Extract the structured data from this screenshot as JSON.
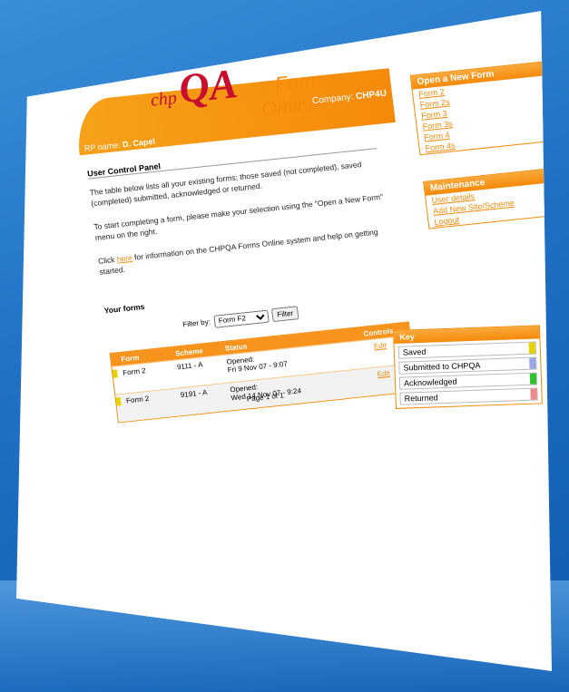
{
  "header": {
    "logo_chp": "chp",
    "logo_qa": "QA",
    "tagline": ":: Forms Online",
    "company_label": "Company:",
    "company_value": "CHP4U",
    "user_label": "RP name:",
    "user_value": "D. Capel"
  },
  "panel": {
    "title": "User Control Panel",
    "para1": "The table below lists all your existing forms; those saved (not completed), saved (completed) submitted, acknowledged or returned.",
    "para2": "To start completing a form, please make your selection using the \"Open a New Form\" menu on the right.",
    "para3_pre": "Click",
    "para3_link": "here",
    "para3_post": "for information on the CHPQA Forms Online system and help on getting started."
  },
  "your_forms": {
    "title": "Your forms",
    "filter_label": "Filter by:",
    "filter_value": "Form F2",
    "filter_button": "Filter",
    "columns": [
      "Form",
      "Scheme",
      "Status",
      "Controls"
    ],
    "rows": [
      {
        "form": "Form 2",
        "scheme": "9111 - A",
        "status": "Opened:",
        "date": "Fri 9 Nov 07 - 9:07",
        "action": "Edit"
      },
      {
        "form": "Form 2",
        "scheme": "9191 - A",
        "status": "Opened:",
        "date": "Wed 14 Nov 07 - 9:24",
        "action": "Edit"
      }
    ],
    "paging": "Page 1 of 1"
  },
  "open_form": {
    "title": "Open a New Form",
    "links": [
      "Form 2",
      "Form 2s",
      "Form 3",
      "Form 3s",
      "Form 4",
      "Form 4s"
    ]
  },
  "maintenance": {
    "title": "Maintenance",
    "links": [
      "User details",
      "Add New Site/Scheme",
      "Logout"
    ]
  },
  "key": {
    "title": "Key",
    "items": [
      {
        "label": "Saved",
        "color": "#e6d200"
      },
      {
        "label": "Submitted to CHPQA",
        "color": "#9aa6e6"
      },
      {
        "label": "Acknowledged",
        "color": "#2fc12f"
      },
      {
        "label": "Returned",
        "color": "#f08a8a"
      }
    ]
  }
}
